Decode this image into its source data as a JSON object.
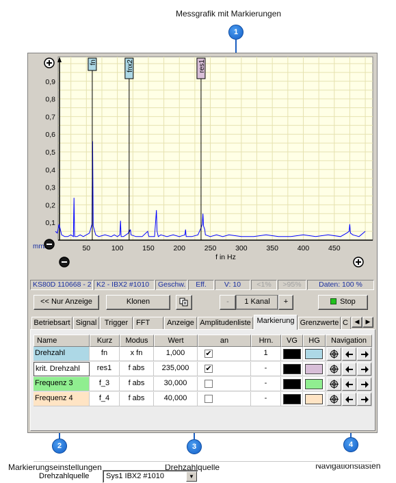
{
  "callouts": {
    "c1": {
      "number": "1",
      "label": "Messgrafik mit Markierungen"
    },
    "c2": {
      "number": "2",
      "label": "Markierungseinstellungen"
    },
    "c3": {
      "number": "3",
      "label": "Drehzahlquelle"
    },
    "c4": {
      "number": "4",
      "label": "Navigationstasten"
    }
  },
  "colors": {
    "chart_bg": "#ffffe6",
    "grid": "#e6e2b0",
    "trace": "#0000ff",
    "status_text": "#1a2fa0",
    "fn_color": "#add8e6",
    "res1_color": "#d8bfd8",
    "f3_color": "#90ee90",
    "f4_color": "#ffe4c4"
  },
  "chart_data": {
    "type": "line",
    "xlabel": "f in Hz",
    "ylabel": "mm/s",
    "xlim": [
      0,
      500
    ],
    "ylim": [
      0,
      1.0
    ],
    "x_ticks": [
      "50",
      "100",
      "150",
      "200",
      "250",
      "300",
      "350",
      "400",
      "450"
    ],
    "y_ticks": [
      "0,1",
      "0,2",
      "0,3",
      "0,4",
      "0,5",
      "0,6",
      "0,7",
      "0,8",
      "0,9"
    ],
    "grid": true,
    "series": [
      {
        "x": [
          0,
          3,
          6,
          10,
          15,
          20,
          25,
          29,
          30,
          31,
          35,
          40,
          45,
          50,
          55,
          59,
          60,
          61,
          65,
          70,
          80,
          90,
          95,
          100,
          104,
          105,
          106,
          110,
          118,
          119,
          120,
          121,
          122,
          130,
          140,
          149,
          150,
          151,
          160,
          162,
          163,
          164,
          166,
          170,
          180,
          190,
          200,
          209,
          210,
          211,
          220,
          230,
          235,
          237,
          238,
          239,
          240,
          241,
          242,
          250,
          260,
          270,
          280,
          300,
          320,
          340,
          360,
          380,
          400,
          420,
          440,
          460,
          470,
          474,
          475,
          476,
          480,
          490,
          500
        ],
        "y": [
          0.05,
          0.04,
          0.09,
          0.03,
          0.02,
          0.02,
          0.03,
          0.02,
          0.24,
          0.02,
          0.02,
          0.03,
          0.02,
          0.03,
          0.04,
          0.09,
          0.56,
          0.08,
          0.03,
          0.02,
          0.03,
          0.02,
          0.03,
          0.02,
          0.03,
          0.11,
          0.02,
          0.02,
          0.04,
          0.06,
          0.05,
          0.06,
          0.03,
          0.02,
          0.02,
          0.05,
          0.03,
          0.02,
          0.02,
          0.12,
          0.17,
          0.05,
          0.02,
          0.03,
          0.02,
          0.03,
          0.02,
          0.03,
          0.06,
          0.02,
          0.02,
          0.03,
          0.07,
          0.09,
          0.15,
          0.08,
          0.07,
          0.06,
          0.03,
          0.02,
          0.03,
          0.02,
          0.03,
          0.02,
          0.02,
          0.03,
          0.02,
          0.02,
          0.03,
          0.02,
          0.03,
          0.02,
          0.04,
          0.05,
          0.09,
          0.04,
          0.03,
          0.02,
          0.05
        ]
      }
    ],
    "markers": [
      {
        "label": "fn",
        "x": 59.5,
        "color": "#add8e6"
      },
      {
        "label": "fnx2",
        "x": 119,
        "color": "#add8e6"
      },
      {
        "label": "res1",
        "x": 235,
        "color": "#d8bfd8"
      }
    ]
  },
  "status": {
    "device": "KS80D 110668 - 2",
    "channel": "K2 - IBX2 #1010",
    "mode": "Geschw.",
    "eff": "Eff.",
    "v": "V: 10",
    "lt": "<1%",
    "gt": ">95%",
    "daten": "Daten: 100 %"
  },
  "toolbar": {
    "only_display": "<< Nur Anzeige",
    "clone": "Klonen",
    "copy_icon": "copy-icon",
    "minus": "-",
    "channel_count": "1 Kanal",
    "plus": "+",
    "stop": "Stop"
  },
  "tabs": [
    "Betriebsart",
    "Signal",
    "Trigger",
    "FFT",
    "Anzeige",
    "Amplitudenliste",
    "Markierung",
    "Grenzwerte",
    "C"
  ],
  "tab_active": "Markierung",
  "grid": {
    "headers": [
      "Name",
      "Kurz",
      "Modus",
      "Wert",
      "an",
      "Hrn.",
      "VG",
      "HG",
      "Navigation"
    ],
    "rows": [
      {
        "name": "Drehzahl",
        "kurz": "fn",
        "modus": "x fn",
        "wert": "1,000",
        "an": "✔",
        "hrn": "1",
        "vg": "#000000",
        "hg": "#add8e6"
      },
      {
        "name": "krit. Drehzahl",
        "kurz": "res1",
        "modus": "f abs",
        "wert": "235,000",
        "an": "✔",
        "hrn": "-",
        "vg": "#000000",
        "hg": "#d8bfd8"
      },
      {
        "name": "Frequenz 3",
        "kurz": "f_3",
        "modus": "f abs",
        "wert": "30,000",
        "an": "",
        "hrn": "-",
        "vg": "#000000",
        "hg": "#90ee90"
      },
      {
        "name": "Frequenz 4",
        "kurz": "f_4",
        "modus": "f abs",
        "wert": "40,000",
        "an": "",
        "hrn": "-",
        "vg": "#000000",
        "hg": "#ffe4c4"
      }
    ]
  },
  "rpm_source": {
    "label": "Drehzahlquelle",
    "value": "Sys1 IBX2 #1010"
  }
}
